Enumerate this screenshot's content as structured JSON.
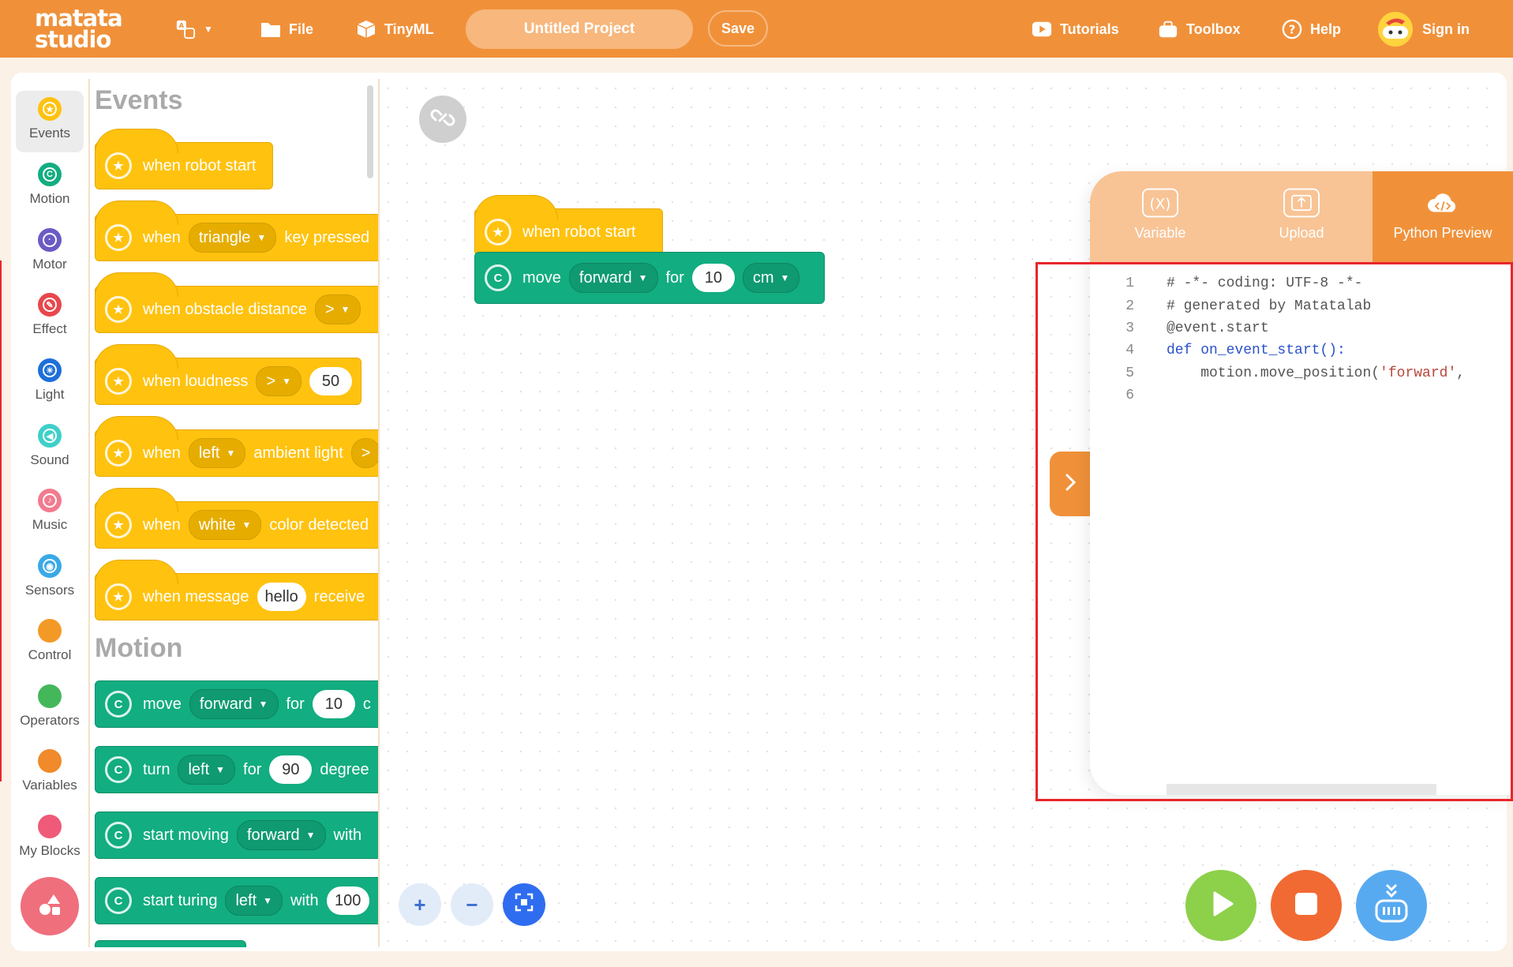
{
  "header": {
    "logo_line1": "matata",
    "logo_line2": "studio",
    "file": "File",
    "tinyml": "TinyML",
    "project_name": "Untitled Project",
    "save": "Save",
    "tutorials": "Tutorials",
    "toolbox": "Toolbox",
    "help": "Help",
    "sign_in": "Sign in"
  },
  "categories": [
    {
      "label": "Events",
      "color": "#ffc20e"
    },
    {
      "label": "Motion",
      "color": "#12ad80"
    },
    {
      "label": "Motor",
      "color": "#6a5bc4"
    },
    {
      "label": "Effect",
      "color": "#e8474d"
    },
    {
      "label": "Light",
      "color": "#1e6fd9"
    },
    {
      "label": "Sound",
      "color": "#3fd0c9"
    },
    {
      "label": "Music",
      "color": "#f27b8e"
    },
    {
      "label": "Sensors",
      "color": "#3aa9e6"
    },
    {
      "label": "Control",
      "color": "#f39a26"
    },
    {
      "label": "Operators",
      "color": "#44b75a"
    },
    {
      "label": "Variables",
      "color": "#f08a2a"
    },
    {
      "label": "My Blocks",
      "color": "#ef5a78"
    }
  ],
  "palette": {
    "events_title": "Events",
    "motion_title": "Motion",
    "events": {
      "robot_start": "when robot start",
      "key_when": "when",
      "key_value": "triangle",
      "key_tail": "key pressed",
      "obstacle": "when obstacle distance",
      "obstacle_op": ">",
      "loud": "when loudness",
      "loud_op": ">",
      "loud_val": "50",
      "amb_when": "when",
      "amb_val": "left",
      "amb_tail": "ambient light",
      "amb_op": ">",
      "col_when": "when",
      "col_val": "white",
      "col_tail": "color detected",
      "msg": "when message",
      "msg_val": "hello",
      "msg_tail": "receive"
    },
    "motion": {
      "move": "move",
      "move_dir": "forward",
      "move_for": "for",
      "move_val": "10",
      "move_tail": "c",
      "turn": "turn",
      "turn_dir": "left",
      "turn_for": "for",
      "turn_val": "90",
      "turn_tail": "degree",
      "start": "start moving",
      "start_dir": "forward",
      "start_with": "with",
      "turning": "start turing",
      "turning_dir": "left",
      "turning_with": "with",
      "turning_val": "100"
    }
  },
  "workspace": {
    "hat": "when robot start",
    "move": "move",
    "move_dir": "forward",
    "move_for": "for",
    "move_val": "10",
    "move_unit": "cm"
  },
  "drawer": {
    "tabs": [
      "Variable",
      "Upload",
      "Python Preview"
    ],
    "code_lines": [
      "# -*- coding: UTF-8 -*-",
      "# generated by Matatalab",
      "@event.start",
      "def on_event_start():",
      "    motion.move_position('forward',",
      ""
    ],
    "line_numbers": [
      "1",
      "2",
      "3",
      "4",
      "5",
      "6"
    ]
  },
  "zoom": {
    "plus": "+",
    "minus": "−"
  }
}
